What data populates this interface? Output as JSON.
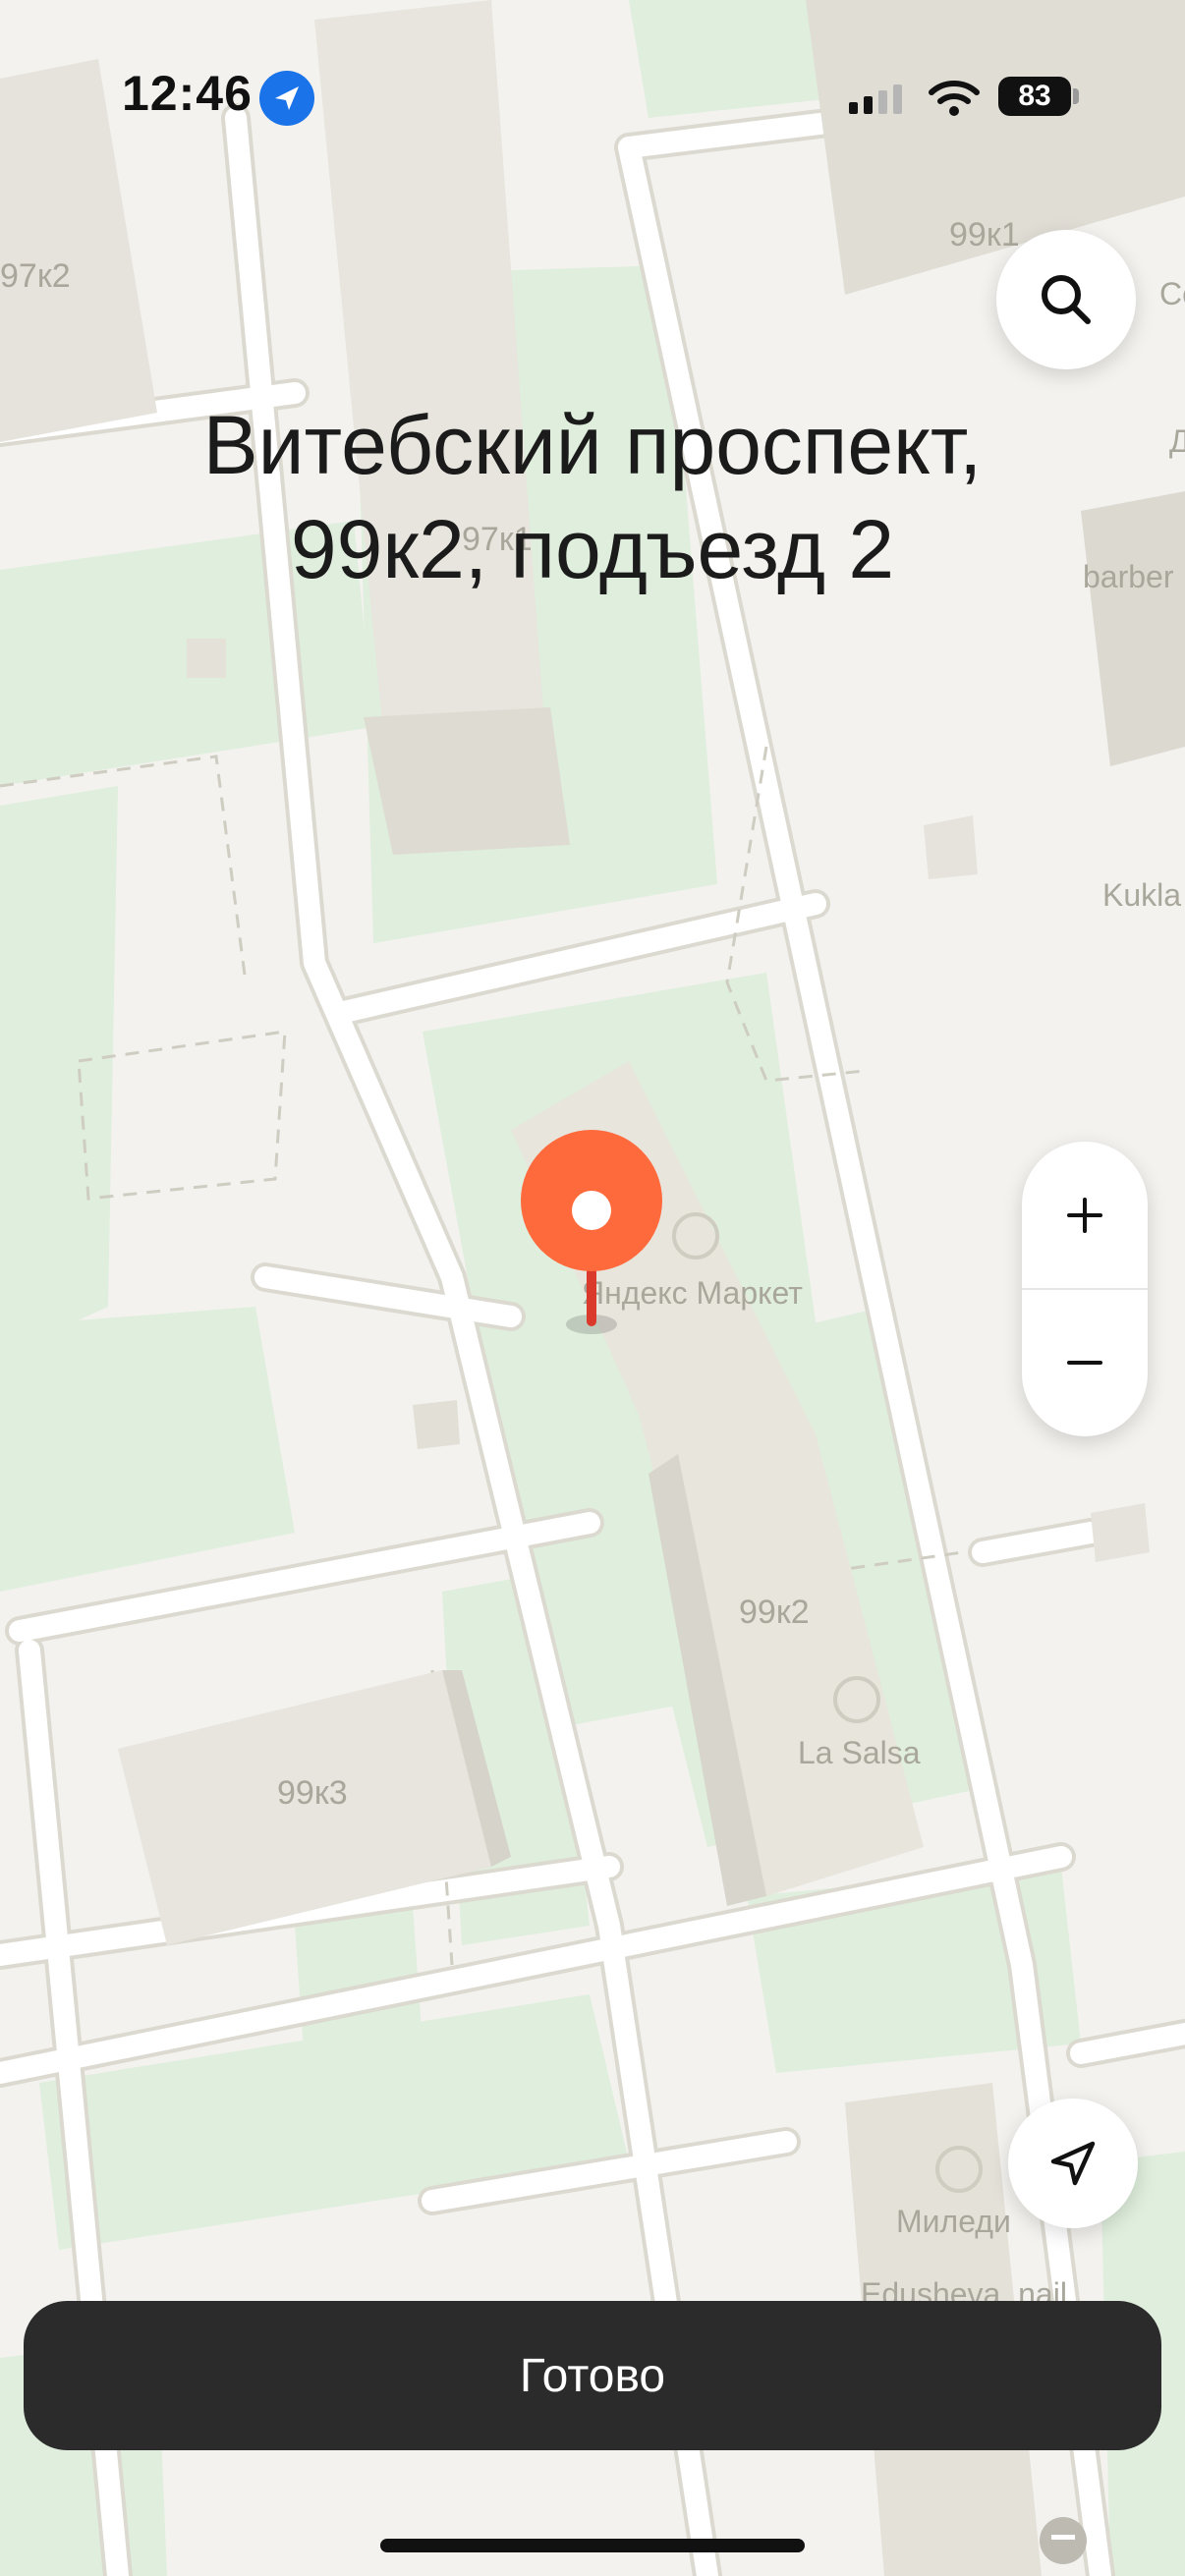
{
  "status_bar": {
    "time": "12:46",
    "battery": "83",
    "icons": [
      "location-arrow-icon",
      "signal-icon",
      "wifi-icon",
      "battery-icon"
    ]
  },
  "address": {
    "line1": "Витебский проспект,",
    "line2": "99к2, подъезд 2"
  },
  "map": {
    "building_labels": [
      "97к2",
      "99к1",
      "97к1",
      "99к2",
      "99к3"
    ],
    "poi_labels": [
      "Яндекс Маркет",
      "La Salsa",
      "Миледи",
      "Edusheva_nail",
      "Kukla",
      "barber",
      "Co",
      "Д"
    ]
  },
  "controls": {
    "zoom_in": "+",
    "zoom_out": "−",
    "search_icon": "search-icon",
    "locate_icon": "navigation-arrow-icon"
  },
  "done_button": {
    "label": "Готово"
  },
  "colors": {
    "pin": "#ff6a3d",
    "pin_stem": "#d93a2b",
    "button_bg": "#2b2b2b",
    "location_badge": "#1a73e8"
  }
}
